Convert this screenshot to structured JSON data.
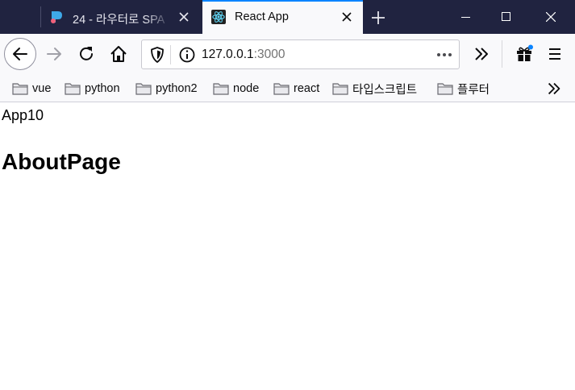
{
  "tabs": [
    {
      "title": "24 - 라우터로 SPA",
      "active": false,
      "favicon": "site-logo-icon"
    },
    {
      "title": "React App",
      "active": true,
      "favicon": "react-logo-icon"
    }
  ],
  "window_controls": [
    "minimize-icon",
    "maximize-icon",
    "close-icon"
  ],
  "address_bar": {
    "host": "127.0.0.1",
    "port": ":3000"
  },
  "bookmarks": [
    {
      "label": "vue"
    },
    {
      "label": "python"
    },
    {
      "label": "python2"
    },
    {
      "label": "node"
    },
    {
      "label": "react"
    },
    {
      "label": "타입스크립트"
    },
    {
      "label": "플루터"
    }
  ],
  "page": {
    "app_label": "App10",
    "heading": "AboutPage"
  },
  "colors": {
    "titlebar": "#202340",
    "active_tab": "#f9f9fb",
    "accent": "#0a84ff",
    "react_logo": "#61dafb"
  }
}
